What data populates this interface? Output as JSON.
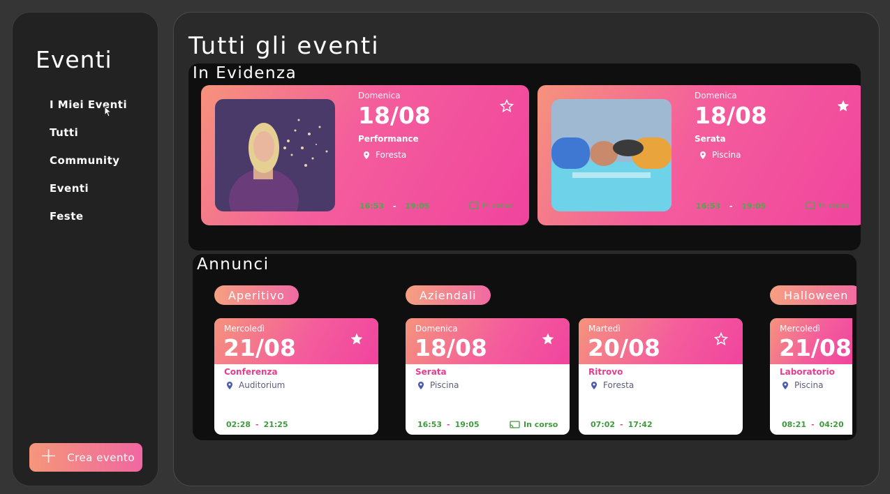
{
  "sidebar": {
    "title": "Eventi",
    "nav": [
      "I Miei Eventi",
      "Tutti",
      "Community",
      "Eventi",
      "Feste"
    ],
    "create_label": "Crea evento"
  },
  "main": {
    "title": "Tutti gli eventi",
    "featured": {
      "title": "In Evidenza",
      "cards": [
        {
          "day": "Domenica",
          "date": "18/08",
          "category": "Performance",
          "location": "Foresta",
          "start": "16:53",
          "end": "19:05",
          "status": "In corso",
          "starred": false,
          "photo_icon": "woman-blowing-glitter-photo"
        },
        {
          "day": "Domenica",
          "date": "18/08",
          "category": "Serata",
          "location": "Piscina",
          "start": "16:53",
          "end": "19:05",
          "status": "In corso",
          "starred": true,
          "photo_icon": "pool-party-photo"
        }
      ]
    },
    "announcements": {
      "title": "Annunci",
      "categories": [
        "Aperitivo",
        "Aziendali",
        "Halloween"
      ],
      "cards": [
        {
          "day": "Mercoledì",
          "date": "21/08",
          "category": "Conferenza",
          "location": "Auditorium",
          "start": "02:28",
          "end": "21:25",
          "status": "",
          "starred": true
        },
        {
          "day": "Domenica",
          "date": "18/08",
          "category": "Serata",
          "location": "Piscina",
          "start": "16:53",
          "end": "19:05",
          "status": "In corso",
          "starred": true
        },
        {
          "day": "Martedì",
          "date": "20/08",
          "category": "Ritrovo",
          "location": "Foresta",
          "start": "07:02",
          "end": "17:42",
          "status": "",
          "starred": false
        },
        {
          "day": "Mercoledì",
          "date": "21/08",
          "category": "Laboratorio",
          "location": "Piscina",
          "start": "08:21",
          "end": "04:20",
          "status": "",
          "starred": false
        }
      ]
    }
  },
  "colors": {
    "accent_start": "#f5937c",
    "accent_end": "#f0449e",
    "time_green": "#3f9a3f",
    "category_pink": "#e53e8f"
  }
}
